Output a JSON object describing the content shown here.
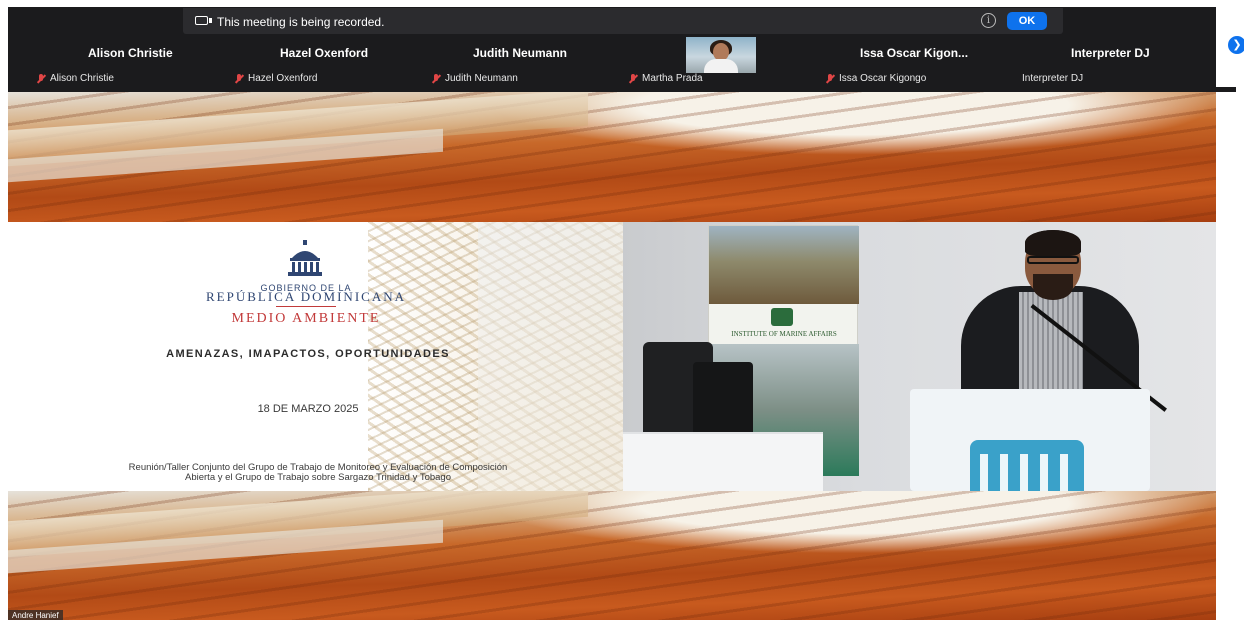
{
  "recording_banner": {
    "text": "This meeting is being recorded.",
    "ok_label": "OK",
    "info_symbol": "i"
  },
  "participant_tiles": [
    {
      "name": "Alison Christie"
    },
    {
      "name": "Hazel Oxenford"
    },
    {
      "name": "Judith Neumann"
    },
    {
      "name": "Issa Oscar Kigon..."
    },
    {
      "name": "Interpreter DJ"
    }
  ],
  "participant_labels": [
    {
      "name": "Alison Christie",
      "muted": true
    },
    {
      "name": "Hazel Oxenford",
      "muted": true
    },
    {
      "name": "Judith Neumann",
      "muted": true
    },
    {
      "name": "Martha Prada",
      "muted": true
    },
    {
      "name": "Issa Oscar Kigongo",
      "muted": true
    },
    {
      "name": "Interpreter DJ",
      "muted": false
    }
  ],
  "next_page_symbol": "❯",
  "slide": {
    "gov_line": "GOBIERNO DE LA",
    "country": "REPÚBLICA DOMINICANA",
    "ministry": "MEDIO AMBIENTE",
    "title": "AMENAZAS, IMAPACTOS, OPORTUNIDADES",
    "date": "18 DE MARZO 2025",
    "footer_line1": "Reunión/Taller Conjunto del Grupo de Trabajo de Monitoreo y Evaluación de Composición",
    "footer_line2": "Abierta y el Grupo de Trabajo sobre Sargazo Trinidad y Tobago"
  },
  "speaker_view": {
    "banner_caption": "INSTITUTE OF MARINE AFFAIRS"
  },
  "active_speaker": {
    "name": "Andre Hanief"
  },
  "colors": {
    "strip_bg": "#1b1b1d",
    "accent_blue": "#0e72ed",
    "muted_red": "#e04646",
    "slide_blue": "#2f4672",
    "slide_red": "#c23a3a"
  }
}
